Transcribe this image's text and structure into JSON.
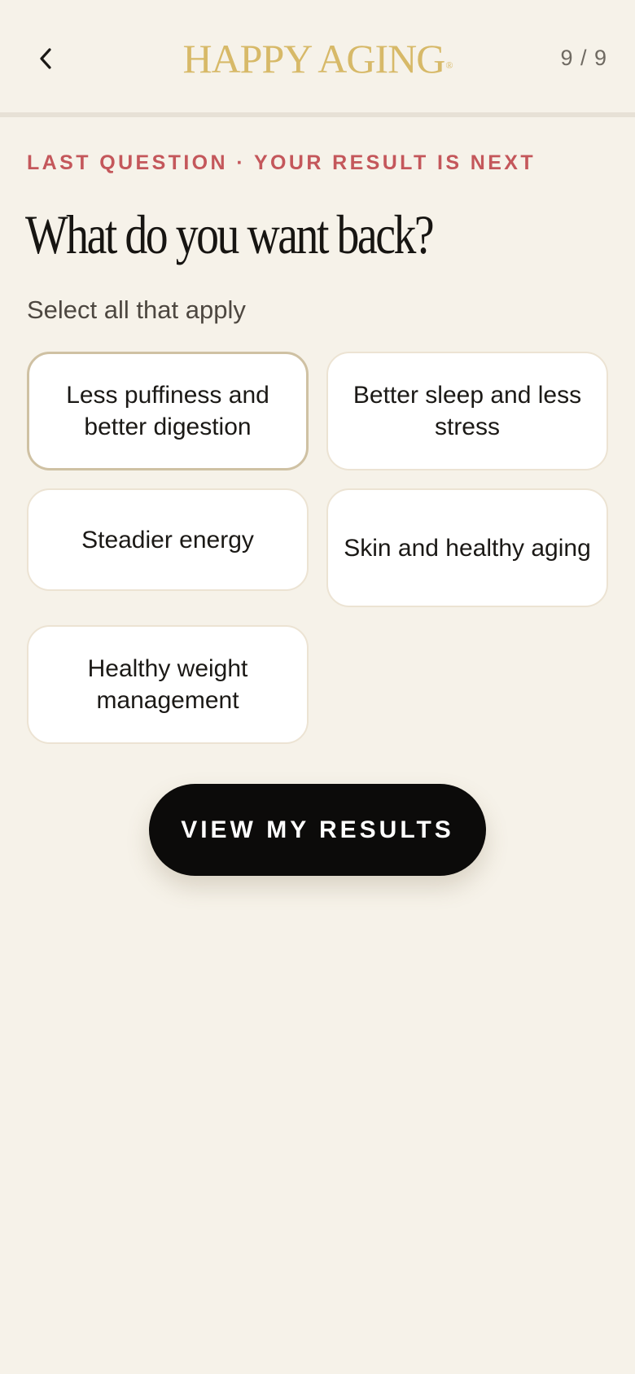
{
  "header": {
    "brand": "HAPPY AGING",
    "brand_mark": "®",
    "step": "9 / 9",
    "back_icon": "chevron-left-icon",
    "progress_fraction": 1.0,
    "brand_color": "#d7b968"
  },
  "eyebrow": "LAST QUESTION · YOUR RESULT IS NEXT",
  "question": "What do you want back?",
  "hint": "Select all that apply",
  "options": [
    {
      "label": "Less puffiness and better digestion",
      "selected": true
    },
    {
      "label": "Better sleep and less stress",
      "selected": false
    },
    {
      "label": "Steadier energy",
      "selected": false
    },
    {
      "label": "Skin and healthy aging",
      "selected": false
    },
    {
      "label": "Healthy weight management",
      "selected": false
    }
  ],
  "cta_label": "VIEW MY RESULTS",
  "colors": {
    "background": "#f6f2e9",
    "accent": "#c4575b",
    "cta": "#0c0b0a",
    "selected_border": "#cfc1a3"
  }
}
